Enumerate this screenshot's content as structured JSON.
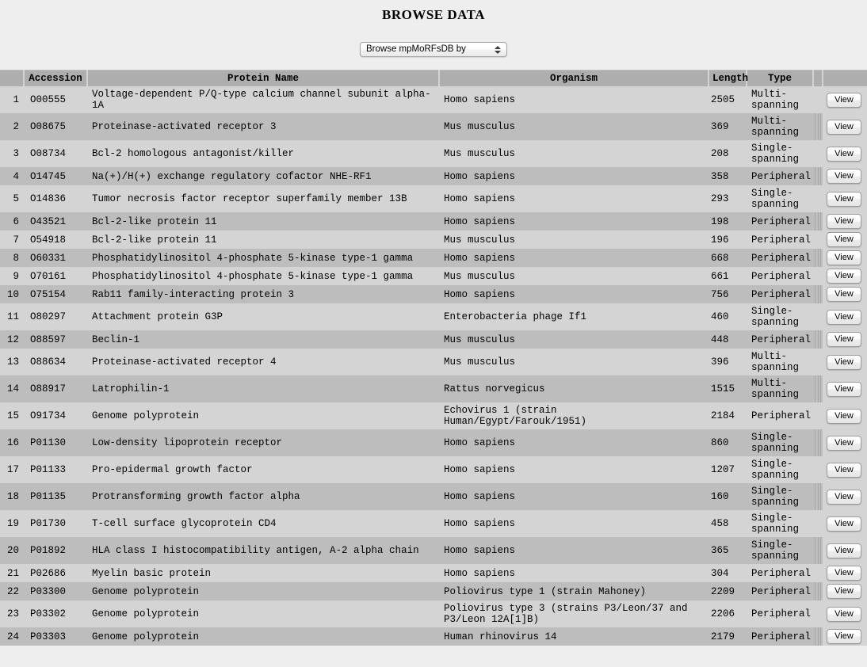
{
  "page": {
    "title": "BROWSE DATA"
  },
  "browse_selector": {
    "selected_label": "Browse mpMoRFsDB by",
    "options": [
      "Browse mpMoRFsDB by"
    ]
  },
  "table": {
    "headers": {
      "index": "",
      "accession": "Accession",
      "protein_name": "Protein Name",
      "organism": "Organism",
      "length": "Length",
      "type": "Type",
      "separator": "",
      "action": ""
    },
    "view_label": "View",
    "rows": [
      {
        "index": "1",
        "accession": "O00555",
        "protein": "Voltage-dependent P/Q-type calcium channel subunit alpha-1A",
        "organism": "Homo sapiens",
        "length": "2505",
        "type": "Multi-spanning",
        "action": "View"
      },
      {
        "index": "2",
        "accession": "O08675",
        "protein": "Proteinase-activated receptor 3",
        "organism": "Mus musculus",
        "length": "369",
        "type": "Multi-spanning",
        "action": "View"
      },
      {
        "index": "3",
        "accession": "O08734",
        "protein": "Bcl-2 homologous antagonist/killer",
        "organism": "Mus musculus",
        "length": "208",
        "type": "Single-spanning",
        "action": "View"
      },
      {
        "index": "4",
        "accession": "O14745",
        "protein": "Na(+)/H(+) exchange regulatory cofactor NHE-RF1",
        "organism": "Homo sapiens",
        "length": "358",
        "type": "Peripheral",
        "action": "View"
      },
      {
        "index": "5",
        "accession": "O14836",
        "protein": "Tumor necrosis factor receptor superfamily member 13B",
        "organism": "Homo sapiens",
        "length": "293",
        "type": "Single-spanning",
        "action": "View"
      },
      {
        "index": "6",
        "accession": "O43521",
        "protein": "Bcl-2-like protein 11",
        "organism": "Homo sapiens",
        "length": "198",
        "type": "Peripheral",
        "action": "View"
      },
      {
        "index": "7",
        "accession": "O54918",
        "protein": "Bcl-2-like protein 11",
        "organism": "Mus musculus",
        "length": "196",
        "type": "Peripheral",
        "action": "View"
      },
      {
        "index": "8",
        "accession": "O60331",
        "protein": "Phosphatidylinositol 4-phosphate 5-kinase type-1 gamma",
        "organism": "Homo sapiens",
        "length": "668",
        "type": "Peripheral",
        "action": "View"
      },
      {
        "index": "9",
        "accession": "O70161",
        "protein": "Phosphatidylinositol 4-phosphate 5-kinase type-1 gamma",
        "organism": "Mus musculus",
        "length": "661",
        "type": "Peripheral",
        "action": "View"
      },
      {
        "index": "10",
        "accession": "O75154",
        "protein": "Rab11 family-interacting protein 3",
        "organism": "Homo sapiens",
        "length": "756",
        "type": "Peripheral",
        "action": "View"
      },
      {
        "index": "11",
        "accession": "O80297",
        "protein": "Attachment protein G3P",
        "organism": "Enterobacteria phage If1",
        "length": "460",
        "type": "Single-spanning",
        "action": "View"
      },
      {
        "index": "12",
        "accession": "O88597",
        "protein": "Beclin-1",
        "organism": "Mus musculus",
        "length": "448",
        "type": "Peripheral",
        "action": "View"
      },
      {
        "index": "13",
        "accession": "O88634",
        "protein": "Proteinase-activated receptor 4",
        "organism": "Mus musculus",
        "length": "396",
        "type": "Multi-spanning",
        "action": "View"
      },
      {
        "index": "14",
        "accession": "O88917",
        "protein": "Latrophilin-1",
        "organism": "Rattus norvegicus",
        "length": "1515",
        "type": "Multi-spanning",
        "action": "View"
      },
      {
        "index": "15",
        "accession": "O91734",
        "protein": "Genome polyprotein",
        "organism": "Echovirus 1 (strain Human/Egypt/Farouk/1951)",
        "length": "2184",
        "type": "Peripheral",
        "action": "View"
      },
      {
        "index": "16",
        "accession": "P01130",
        "protein": "Low-density lipoprotein receptor",
        "organism": "Homo sapiens",
        "length": "860",
        "type": "Single-spanning",
        "action": "View"
      },
      {
        "index": "17",
        "accession": "P01133",
        "protein": "Pro-epidermal growth factor",
        "organism": "Homo sapiens",
        "length": "1207",
        "type": "Single-spanning",
        "action": "View"
      },
      {
        "index": "18",
        "accession": "P01135",
        "protein": "Protransforming growth factor alpha",
        "organism": "Homo sapiens",
        "length": "160",
        "type": "Single-spanning",
        "action": "View"
      },
      {
        "index": "19",
        "accession": "P01730",
        "protein": "T-cell surface glycoprotein CD4",
        "organism": "Homo sapiens",
        "length": "458",
        "type": "Single-spanning",
        "action": "View"
      },
      {
        "index": "20",
        "accession": "P01892",
        "protein": "HLA class I histocompatibility antigen, A-2 alpha chain",
        "organism": "Homo sapiens",
        "length": "365",
        "type": "Single-spanning",
        "action": "View"
      },
      {
        "index": "21",
        "accession": "P02686",
        "protein": "Myelin basic protein",
        "organism": "Homo sapiens",
        "length": "304",
        "type": "Peripheral",
        "action": "View"
      },
      {
        "index": "22",
        "accession": "P03300",
        "protein": "Genome polyprotein",
        "organism": "Poliovirus type 1 (strain Mahoney)",
        "length": "2209",
        "type": "Peripheral",
        "action": "View"
      },
      {
        "index": "23",
        "accession": "P03302",
        "protein": "Genome polyprotein",
        "organism": "Poliovirus type 3 (strains P3/Leon/37 and P3/Leon 12A[1]B)",
        "length": "2206",
        "type": "Peripheral",
        "action": "View"
      },
      {
        "index": "24",
        "accession": "P03303",
        "protein": "Genome polyprotein",
        "organism": "Human rhinovirus 14",
        "length": "2179",
        "type": "Peripheral",
        "action": "View"
      }
    ]
  },
  "colors": {
    "page_background": "#eeeeee",
    "header_row": "#aeaeae",
    "row_light": "#d4d4d4",
    "row_dark": "#bdbdbd"
  }
}
